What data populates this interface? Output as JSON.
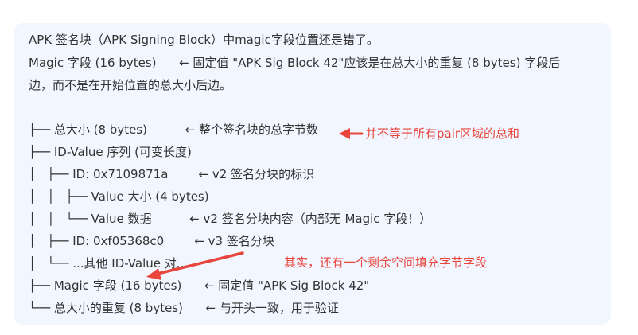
{
  "intro": {
    "line1": "APK 签名块（APK Signing Block）中magic字段位置还是错了。",
    "line2": "Magic 字段 (16 bytes)      ← 固定值 \"APK Sig Block 42\"应该是在总大小的重复 (8 bytes) 字段后",
    "line3": "边，而不是在开始位置的总大小后边。"
  },
  "tree": [
    "├── 总大小 (8 bytes)          ← 整个签名块的总字节数",
    "├── ID-Value 序列 (可变长度)",
    "│   ├── ID: 0x7109871a        ← v2 签名分块的标识",
    "│   │   ├── Value 大小 (4 bytes)",
    "│   │   └── Value 数据          ← v2 签名分块内容（内部无 Magic 字段！）",
    "│   ├── ID: 0xf05368c0        ← v3 签名分块",
    "│   └── ...其他 ID-Value 对...",
    "├── Magic 字段 (16 bytes)      ← 固定值 \"APK Sig Block 42\"",
    "└── 总大小的重复 (8 bytes)      ← 与开头一致，用于验证"
  ],
  "annotations": {
    "note1": "并不等于所有pair区域的总和",
    "note2": "其实，还有一个剩余空间填充字节字段"
  },
  "colors": {
    "background": "#ffffff",
    "card": "#f2f6ff",
    "text": "#333333",
    "annotation": "#e8453c"
  },
  "icons": {
    "annotation_arrow": "red-arrow-icon"
  }
}
